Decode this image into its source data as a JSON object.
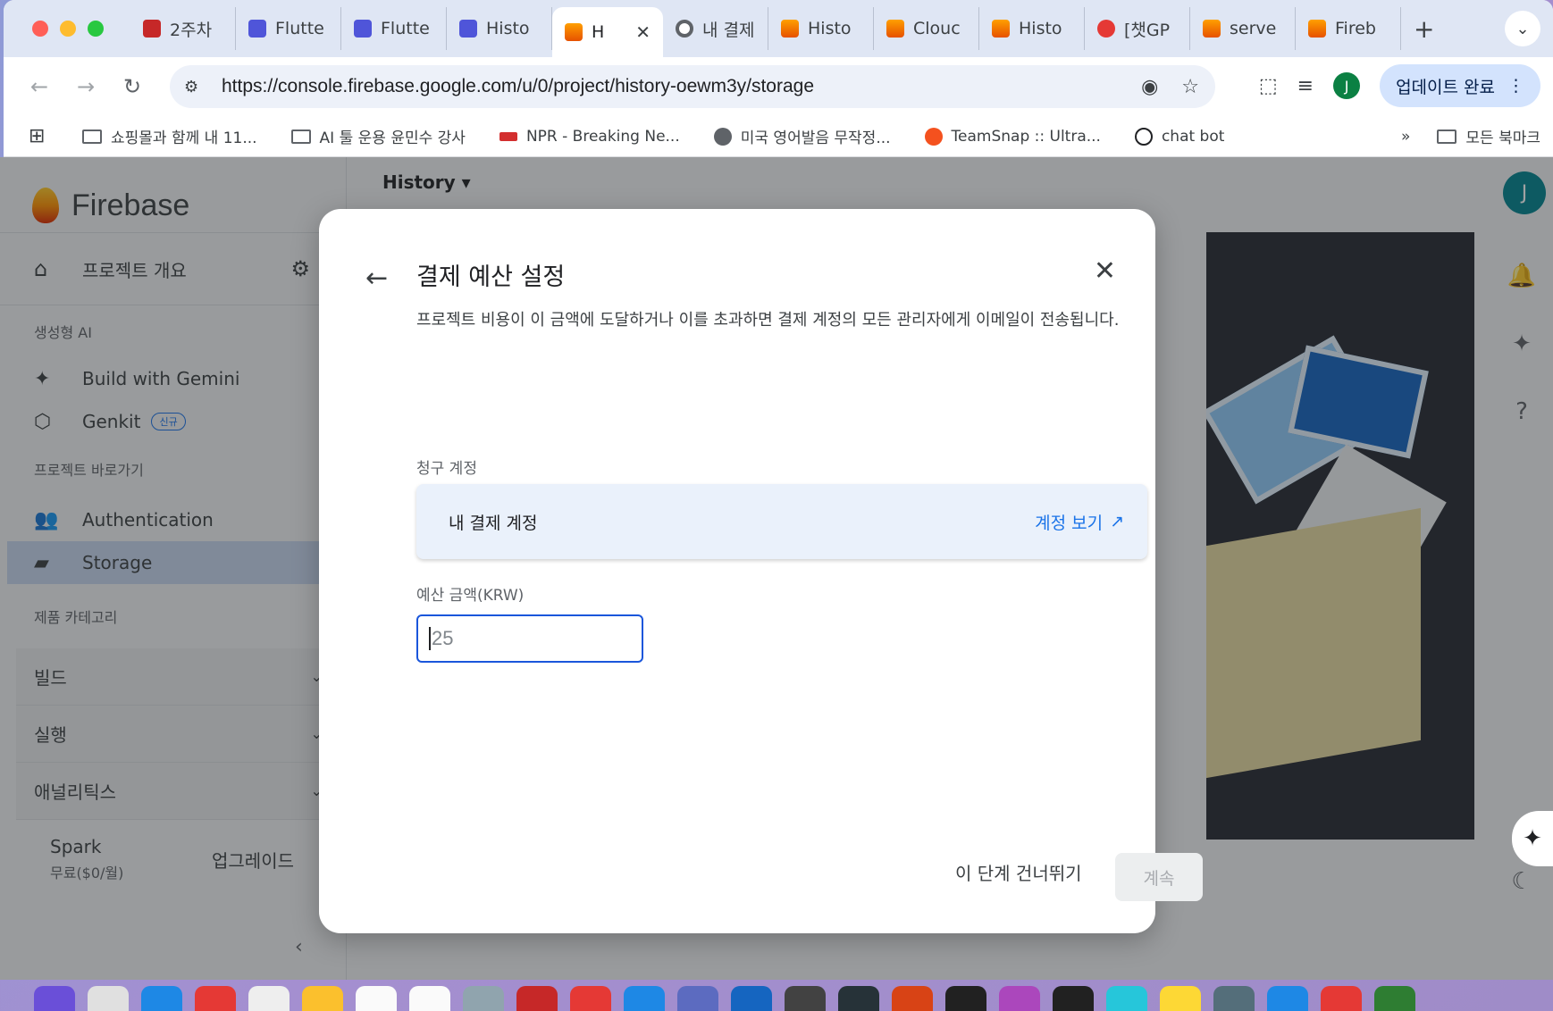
{
  "browser": {
    "tabs": [
      {
        "label": "2주차",
        "icon": "book-icon",
        "color": "#c62828"
      },
      {
        "label": "Flutte",
        "icon": "flutterflow-icon"
      },
      {
        "label": "Flutte",
        "icon": "flutterflow-icon"
      },
      {
        "label": "Histo",
        "icon": "flutterflow-icon"
      },
      {
        "label": "H",
        "icon": "firebase-icon",
        "active": true
      },
      {
        "label": "내 결제",
        "icon": "chrome-icon"
      },
      {
        "label": "Histo",
        "icon": "firebase-icon"
      },
      {
        "label": "Clouc",
        "icon": "firebase-icon"
      },
      {
        "label": "Histo",
        "icon": "firebase-icon"
      },
      {
        "label": "[챗GP",
        "icon": "gpt-icon"
      },
      {
        "label": "serve",
        "icon": "firebase-icon"
      },
      {
        "label": "Fireb",
        "icon": "firebase-icon"
      }
    ],
    "close_tab_glyph": "✕",
    "new_tab_glyph": "+",
    "url": "https://console.firebase.google.com/u/0/project/history-oewm3y/storage",
    "update_button": "업데이트 완료",
    "profile_initial": "J",
    "bookmarks": [
      {
        "label": "쇼핑몰과 함께 내 11...",
        "type": "folder"
      },
      {
        "label": "AI 툴 운용 윤민수 강사",
        "type": "folder"
      },
      {
        "label": "NPR - Breaking Ne...",
        "type": "site",
        "color": "#d32f2f"
      },
      {
        "label": "미국 영어발음 무작정...",
        "type": "site",
        "color": "#5f6368"
      },
      {
        "label": "TeamSnap :: Ultra...",
        "type": "site",
        "color": "#f4511e"
      },
      {
        "label": "chat bot",
        "type": "site",
        "color": "#202124"
      }
    ],
    "more_bookmarks": "»",
    "all_bookmarks": "모든 북마크"
  },
  "sidebar": {
    "brand": "Firebase",
    "overview": "프로젝트 개요",
    "section_ai": "생성형 AI",
    "ai_items": [
      {
        "label": "Build with Gemini",
        "icon": "sparkle-icon"
      },
      {
        "label": "Genkit",
        "icon": "genkit-icon",
        "badge": "신규"
      }
    ],
    "section_shortcuts": "프로젝트 바로가기",
    "shortcut_items": [
      {
        "label": "Authentication",
        "icon": "people-icon"
      },
      {
        "label": "Storage",
        "icon": "photo-folder-icon",
        "active": true
      }
    ],
    "section_categories": "제품 카테고리",
    "groups": [
      "빌드",
      "실행",
      "애널리틱스"
    ],
    "plan_name": "Spark",
    "plan_price": "무료($0/월)",
    "upgrade": "업그레이드"
  },
  "main": {
    "project_selector": "History"
  },
  "dialog": {
    "title": "결제 예산 설정",
    "description": "프로젝트 비용이 이 금액에 도달하거나 이를 초과하면 결제 계정의 모든 관리자에게 이메일이 전송됩니다.",
    "billing_account_label": "청구 계정",
    "billing_account_name": "내 결제 계정",
    "view_account_link": "계정 보기",
    "budget_label": "예산 금액(KRW)",
    "budget_value": "25",
    "skip_button": "이 단계 건너뛰기",
    "continue_button": "계속"
  },
  "colors": {
    "accent": "#1a73e8",
    "input_border": "#1a56db",
    "active_nav": "#c6d6ee"
  }
}
